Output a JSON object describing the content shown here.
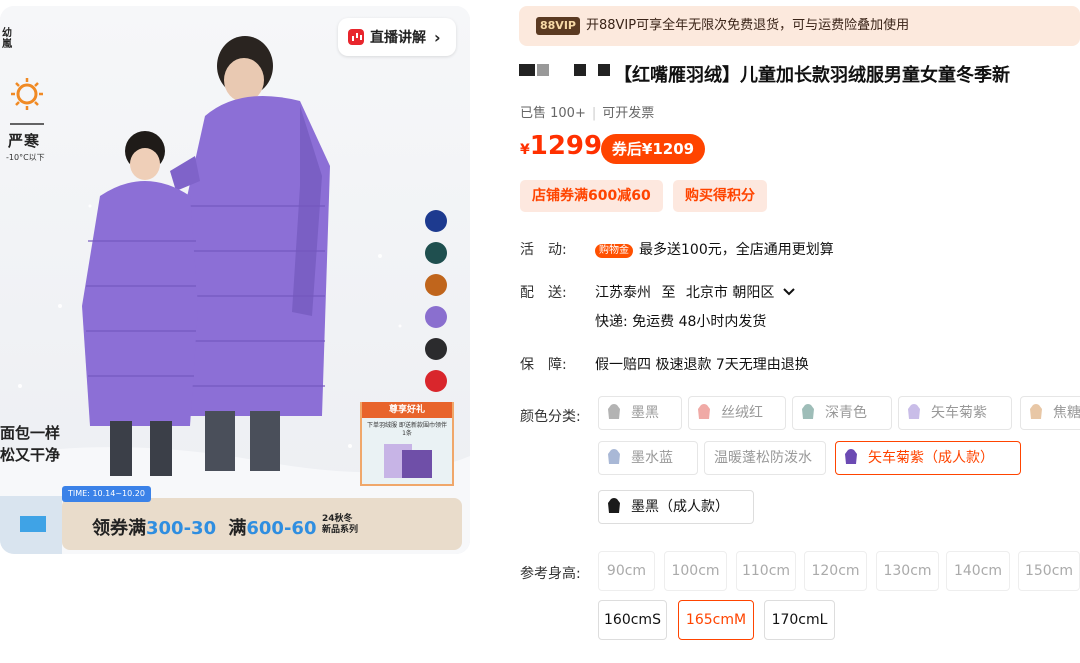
{
  "hero": {
    "brand_top": "幼嵐",
    "cold_label": "严寒",
    "cold_sub": "-10°C以下",
    "live_label": "直播讲解",
    "slogan_line1": "面包一样",
    "slogan_line2": "松又干净",
    "swatches": [
      "#1d3a8f",
      "#1f4f4f",
      "#c0651c",
      "#8a6fcf",
      "#2b2b2d",
      "#d9262c"
    ],
    "gift_head": "尊享好礼",
    "gift_body": "下单羽绒服 即送新款围巾领伴1条",
    "banner_time": "TIME: 10.14~10.20",
    "banner_a": "领券满",
    "banner_b": "300-30",
    "banner_c": "满",
    "banner_d": "600-60",
    "banner_new1": "24秋冬",
    "banner_new2": "新品系列"
  },
  "vip": {
    "badge": "88VIP",
    "text": "开88VIP可享全年无限次免费退货，可与运费险叠加使用"
  },
  "title": "【红嘴雁羽绒】儿童加长款羽绒服男童女童冬季新",
  "sold": "已售 100+",
  "invoice": "可开发票",
  "price": {
    "currency": "¥",
    "value": "1299",
    "coupon": "券后¥1209"
  },
  "tags": [
    "店铺券满600减60",
    "购买得积分"
  ],
  "activity": {
    "label": "活　动:",
    "badge": "购物金",
    "text": "最多送100元，全店通用更划算"
  },
  "shipping": {
    "label": "配　送:",
    "from": "江苏泰州",
    "to_word": "至",
    "dest": "北京市 朝阳区",
    "line2": "快递: 免运费  48小时内发货"
  },
  "guarantee": {
    "label": "保　障:",
    "text": "假一赔四 极速退款 7天无理由退换"
  },
  "color": {
    "label": "颜色分类:",
    "options": [
      {
        "name": "墨黑",
        "icon": "#b3b3b3",
        "state": "normal"
      },
      {
        "name": "丝绒红",
        "icon": "#f0aaa6",
        "state": "normal"
      },
      {
        "name": "深青色",
        "icon": "#9ebdb8",
        "state": "normal"
      },
      {
        "name": "矢车菊紫",
        "icon": "#c9bde8",
        "state": "normal"
      },
      {
        "name": "焦糖",
        "icon": "#e8c7a6",
        "state": "normal"
      },
      {
        "name": "墨水蓝",
        "icon": "#a9b8d6",
        "state": "normal"
      },
      {
        "name": "温暖蓬松防泼水",
        "icon": "",
        "state": "normal"
      },
      {
        "name": "矢车菊紫（成人款）",
        "icon": "#6b4ab3",
        "state": "selected"
      },
      {
        "name": "墨黑（成人款）",
        "icon": "#1a1a1a",
        "state": "available"
      }
    ]
  },
  "size": {
    "label": "参考身高:",
    "options": [
      {
        "name": "90cm",
        "state": "normal"
      },
      {
        "name": "100cm",
        "state": "normal"
      },
      {
        "name": "110cm",
        "state": "normal"
      },
      {
        "name": "120cm",
        "state": "normal"
      },
      {
        "name": "130cm",
        "state": "normal"
      },
      {
        "name": "140cm",
        "state": "normal"
      },
      {
        "name": "150cm",
        "state": "normal"
      },
      {
        "name": "160cmS",
        "state": "available"
      },
      {
        "name": "165cmM",
        "state": "selected"
      },
      {
        "name": "170cmL",
        "state": "available"
      }
    ]
  }
}
